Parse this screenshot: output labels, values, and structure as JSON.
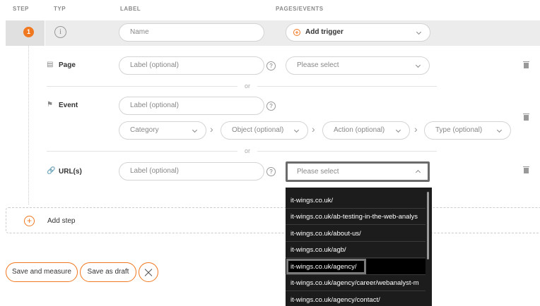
{
  "headers": {
    "step": "STEP",
    "typ": "TYP",
    "label": "LABEL",
    "pages_events": "PAGES/EVENTS"
  },
  "step": {
    "number": "1",
    "info_glyph": "i",
    "name_placeholder": "Name",
    "add_trigger": "Add trigger"
  },
  "page_row": {
    "label": "Page",
    "label_placeholder": "Label (optional)",
    "select": "Please select",
    "help": "?"
  },
  "or_text": "or",
  "event_row": {
    "label": "Event",
    "label_placeholder": "Label (optional)",
    "help": "?",
    "category": "Category",
    "object": "Object (optional)",
    "action": "Action (optional)",
    "type": "Type (optional)"
  },
  "url_row": {
    "label": "URL(s)",
    "label_placeholder": "Label (optional)",
    "help": "?",
    "select": "Please select",
    "options": [
      "it-wings.co.uk/",
      "it-wings.co.uk/ab-testing-in-the-web-analys",
      "it-wings.co.uk/about-us/",
      "it-wings.co.uk/agb/",
      "it-wings.co.uk/agency/",
      "it-wings.co.uk/agency/career/webanalyst-m",
      "it-wings.co.uk/agency/contact/"
    ],
    "highlighted_index": 4
  },
  "add_step": "Add step",
  "buttons": {
    "save_measure": "Save and measure",
    "save_draft": "Save as draft"
  },
  "colors": {
    "accent": "#f07820",
    "dropdown_bg": "#1c1c1c"
  }
}
